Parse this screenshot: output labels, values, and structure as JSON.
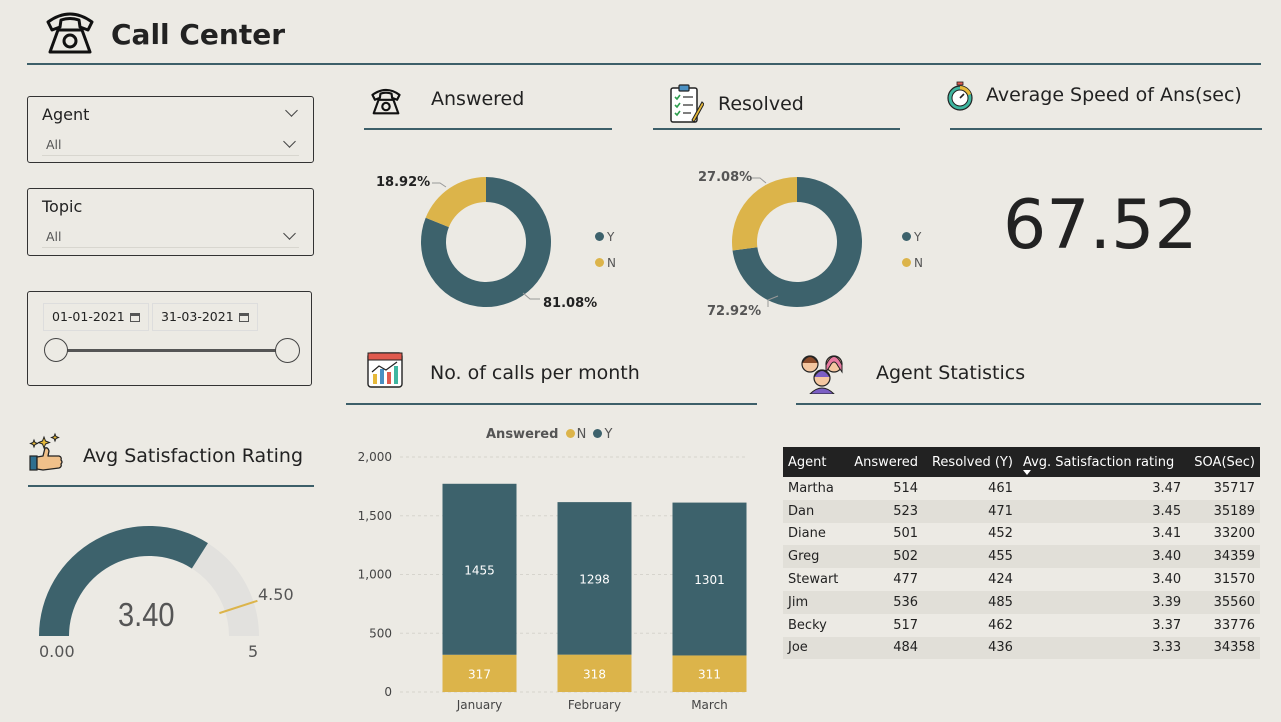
{
  "header": {
    "title": "Call Center"
  },
  "filters": {
    "agent": {
      "label": "Agent",
      "value": "All"
    },
    "topic": {
      "label": "Topic",
      "value": "All"
    },
    "date": {
      "start": "01-01-2021",
      "end": "31-03-2021"
    }
  },
  "answered": {
    "title": "Answered",
    "legend": [
      "Y",
      "N"
    ],
    "y_pct_label": "81.08%",
    "n_pct_label": "18.92%",
    "y_pct": 81.08,
    "n_pct": 18.92
  },
  "resolved": {
    "title": "Resolved",
    "legend": [
      "Y",
      "N"
    ],
    "y_pct_label": "72.92%",
    "n_pct_label": "27.08%",
    "y_pct": 72.92,
    "n_pct": 27.08
  },
  "speed": {
    "title": "Average Speed of Ans(sec)",
    "value": "67.52"
  },
  "satisfaction": {
    "title": "Avg Satisfaction Rating",
    "value": 3.4,
    "value_label": "3.40",
    "min": 0,
    "min_label": "0.00",
    "max": 5,
    "max_label": "5",
    "target": 4.5,
    "target_label": "4.50"
  },
  "calls": {
    "title": "No. of calls per month",
    "legend_title": "Answered",
    "legend": [
      "N",
      "Y"
    ]
  },
  "agent_stats": {
    "title": "Agent Statistics",
    "columns": [
      "Agent",
      "Answered",
      "Resolved (Y)",
      "Avg. Satisfaction rating",
      "SOA(Sec)"
    ],
    "rows": [
      [
        "Martha",
        "514",
        "461",
        "3.47",
        "35717"
      ],
      [
        "Dan",
        "523",
        "471",
        "3.45",
        "35189"
      ],
      [
        "Diane",
        "501",
        "452",
        "3.41",
        "33200"
      ],
      [
        "Greg",
        "502",
        "455",
        "3.40",
        "34359"
      ],
      [
        "Stewart",
        "477",
        "424",
        "3.40",
        "31570"
      ],
      [
        "Jim",
        "536",
        "485",
        "3.39",
        "35560"
      ],
      [
        "Becky",
        "517",
        "462",
        "3.37",
        "33776"
      ],
      [
        "Joe",
        "484",
        "436",
        "3.33",
        "34358"
      ]
    ]
  },
  "colors": {
    "teal": "#3d626c",
    "gold": "#dcb44a",
    "gauge_bg": "#e2e1de"
  },
  "chart_data": [
    {
      "type": "pie",
      "title": "Answered",
      "categories": [
        "Y",
        "N"
      ],
      "values": [
        81.08,
        18.92
      ]
    },
    {
      "type": "pie",
      "title": "Resolved",
      "categories": [
        "Y",
        "N"
      ],
      "values": [
        72.92,
        27.08
      ]
    },
    {
      "type": "bar",
      "stacked": true,
      "title": "No. of calls per month",
      "categories": [
        "January",
        "February",
        "March"
      ],
      "series": [
        {
          "name": "N",
          "values": [
            317,
            318,
            311
          ]
        },
        {
          "name": "Y",
          "values": [
            1455,
            1298,
            1301
          ]
        }
      ],
      "yticks": [
        "0",
        "500",
        "1,000",
        "1,500",
        "2,000"
      ],
      "ylim": [
        0,
        2000
      ],
      "legend_title": "Answered",
      "legend": "top"
    }
  ]
}
